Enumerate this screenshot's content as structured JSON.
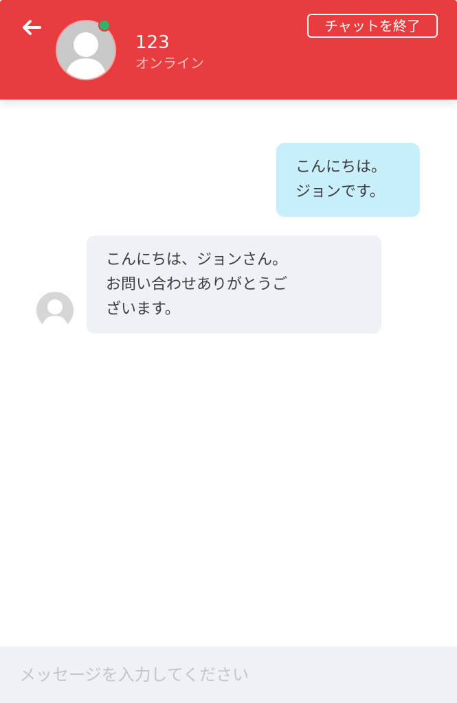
{
  "header": {
    "back_icon": "arrow-left-icon",
    "contact_name": "123",
    "contact_status": "オンライン",
    "end_chat_label": "チャットを終了",
    "avatar_icon": "user-avatar-icon",
    "status_indicator_color": "#2fb36b",
    "background_color": "#e83c3f"
  },
  "messages": [
    {
      "direction": "outgoing",
      "lines": [
        "こんにちは。",
        "ジョンです。"
      ],
      "bubble_color": "#c9eefc"
    },
    {
      "direction": "incoming",
      "lines": [
        "こんにちは、ジョンさん。",
        "お問い合わせありがとうご",
        "ざいます。"
      ],
      "bubble_color": "#eef1f5",
      "avatar_icon": "user-avatar-icon"
    }
  ],
  "composer": {
    "value": "",
    "placeholder": "メッセージを入力してください"
  }
}
